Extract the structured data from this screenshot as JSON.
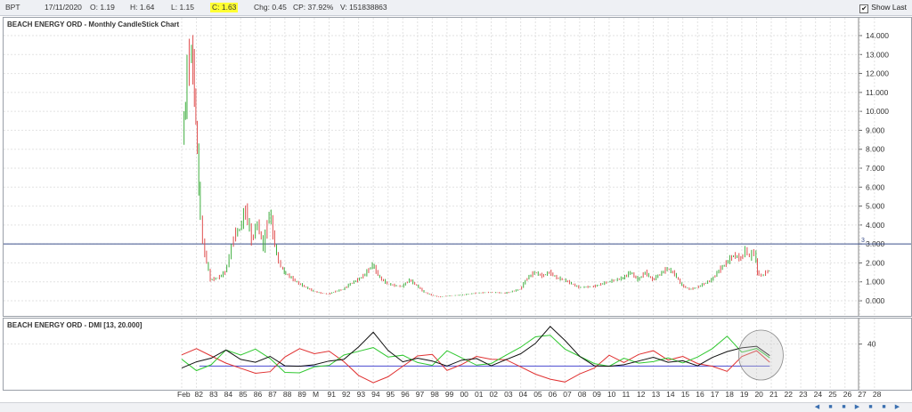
{
  "toolbar": {
    "symbol": "BPT",
    "date": "17/11/2020",
    "open": "O: 1.19",
    "high": "H: 1.64",
    "low": "L: 1.15",
    "close": "C: 1.63",
    "change": "Chg: 0.45",
    "change_pct": "CP: 37.92%",
    "volume": "V: 151838863",
    "show_last": "Show Last",
    "show_last_checked": "✔"
  },
  "chart_data": [
    {
      "type": "line",
      "title": "BEACH ENERGY ORD - Monthly CandleStick Chart",
      "ylim": [
        0,
        14
      ],
      "yticks": [
        "14.000",
        "13.000",
        "12.000",
        "11.000",
        "10.000",
        "9.000",
        "8.000",
        "7.000",
        "6.000",
        "5.000",
        "4.000",
        "3.000",
        "2.000",
        "1.000",
        "0.000"
      ],
      "horizontal_line": {
        "value": 3,
        "label": "3",
        "color": "#3b4f8a"
      },
      "x": [
        1981.1,
        1981.3,
        1981.6,
        1981.8,
        1982.0,
        1982.2,
        1982.5,
        1983.0,
        1983.5,
        1984.0,
        1984.3,
        1984.6,
        1985.0,
        1985.4,
        1985.8,
        1986.2,
        1986.6,
        1987.0,
        1987.5,
        1987.8,
        1988.0,
        1988.5,
        1989.0,
        1989.5,
        1990.0,
        1990.5,
        1991.0,
        1991.5,
        1992.0,
        1992.5,
        1993.0,
        1993.5,
        1994.0,
        1994.5,
        1995.0,
        1995.5,
        1996.0,
        1996.5,
        1997.0,
        1997.5,
        1998.0,
        1998.5,
        1999.0,
        2000.0,
        2001.0,
        2002.0,
        2003.0,
        2004.0,
        2004.5,
        2005.0,
        2005.5,
        2006.0,
        2006.5,
        2007.0,
        2007.5,
        2008.0,
        2009.0,
        2010.0,
        2011.0,
        2011.5,
        2012.0,
        2012.5,
        2013.0,
        2013.5,
        2014.0,
        2014.5,
        2015.0,
        2015.5,
        2016.0,
        2016.5,
        2017.0,
        2017.5,
        2018.0,
        2018.5,
        2019.0,
        2019.3,
        2019.6,
        2019.9,
        2020.1,
        2020.4,
        2020.7,
        2020.9
      ],
      "series": [
        {
          "values": [
            8.6,
            10.5,
            13.2,
            12.4,
            9.5,
            6.0,
            3.0,
            1.1,
            1.2,
            1.5,
            2.3,
            3.4,
            3.8,
            4.8,
            3.2,
            4.1,
            2.8,
            4.7,
            2.4,
            1.8,
            1.5,
            1.2,
            0.9,
            0.7,
            0.5,
            0.4,
            0.35,
            0.5,
            0.6,
            0.9,
            1.1,
            1.4,
            1.9,
            1.2,
            0.9,
            0.8,
            0.75,
            1.1,
            0.8,
            0.45,
            0.3,
            0.2,
            0.25,
            0.3,
            0.4,
            0.45,
            0.4,
            0.6,
            1.2,
            1.5,
            1.3,
            1.5,
            1.2,
            1.1,
            0.9,
            0.7,
            0.75,
            1.0,
            1.2,
            1.5,
            1.1,
            1.5,
            1.1,
            1.4,
            1.7,
            1.4,
            0.8,
            0.6,
            0.7,
            0.9,
            1.1,
            1.6,
            2.0,
            2.4,
            2.2,
            2.7,
            2.3,
            2.6,
            1.5,
            1.3,
            1.5,
            1.6
          ]
        }
      ]
    },
    {
      "type": "line",
      "title": "BEACH ENERGY ORD - DMI [13, 20.000]",
      "ylim": [
        0,
        60
      ],
      "yticks": [
        "40"
      ],
      "adx_threshold": 20,
      "x_tick_labels": [
        "Feb",
        "82",
        "83",
        "84",
        "85",
        "86",
        "87",
        "88",
        "89",
        "M",
        "91",
        "92",
        "93",
        "94",
        "95",
        "96",
        "97",
        "98",
        "99",
        "00",
        "01",
        "02",
        "03",
        "04",
        "05",
        "06",
        "07",
        "08",
        "09",
        "10",
        "11",
        "12",
        "13",
        "14",
        "15",
        "16",
        "17",
        "18",
        "19",
        "20",
        "21",
        "22",
        "23",
        "24",
        "25",
        "26",
        "27",
        "28"
      ],
      "x": [
        1981,
        1982,
        1983,
        1984,
        1985,
        1986,
        1987,
        1988,
        1989,
        1990,
        1991,
        1992,
        1993,
        1994,
        1995,
        1996,
        1997,
        1998,
        1999,
        2000,
        2001,
        2002,
        2003,
        2004,
        2005,
        2006,
        2007,
        2008,
        2009,
        2010,
        2011,
        2012,
        2013,
        2014,
        2015,
        2016,
        2017,
        2018,
        2019,
        2020,
        2020.9
      ],
      "series": [
        {
          "color": "#e03030",
          "values": [
            32,
            34,
            28,
            22,
            18,
            14,
            16,
            30,
            34,
            30,
            33,
            24,
            12,
            6,
            12,
            18,
            28,
            30,
            16,
            22,
            30,
            28,
            24,
            18,
            12,
            8,
            6,
            14,
            20,
            28,
            22,
            30,
            34,
            26,
            30,
            24,
            18,
            14,
            28,
            34,
            24
          ]
        },
        {
          "color": "#30c830",
          "values": [
            28,
            14,
            20,
            34,
            30,
            36,
            28,
            16,
            12,
            18,
            20,
            30,
            34,
            38,
            30,
            28,
            22,
            20,
            34,
            28,
            22,
            24,
            28,
            36,
            46,
            48,
            36,
            30,
            24,
            18,
            26,
            22,
            24,
            28,
            24,
            30,
            34,
            46,
            32,
            36,
            28
          ]
        },
        {
          "color": "#111111",
          "values": [
            20,
            22,
            26,
            34,
            26,
            24,
            30,
            22,
            18,
            20,
            24,
            26,
            38,
            52,
            36,
            22,
            26,
            24,
            20,
            26,
            28,
            22,
            24,
            30,
            40,
            56,
            44,
            30,
            22,
            18,
            20,
            24,
            28,
            24,
            26,
            22,
            26,
            32,
            36,
            38,
            30
          ]
        }
      ]
    }
  ]
}
